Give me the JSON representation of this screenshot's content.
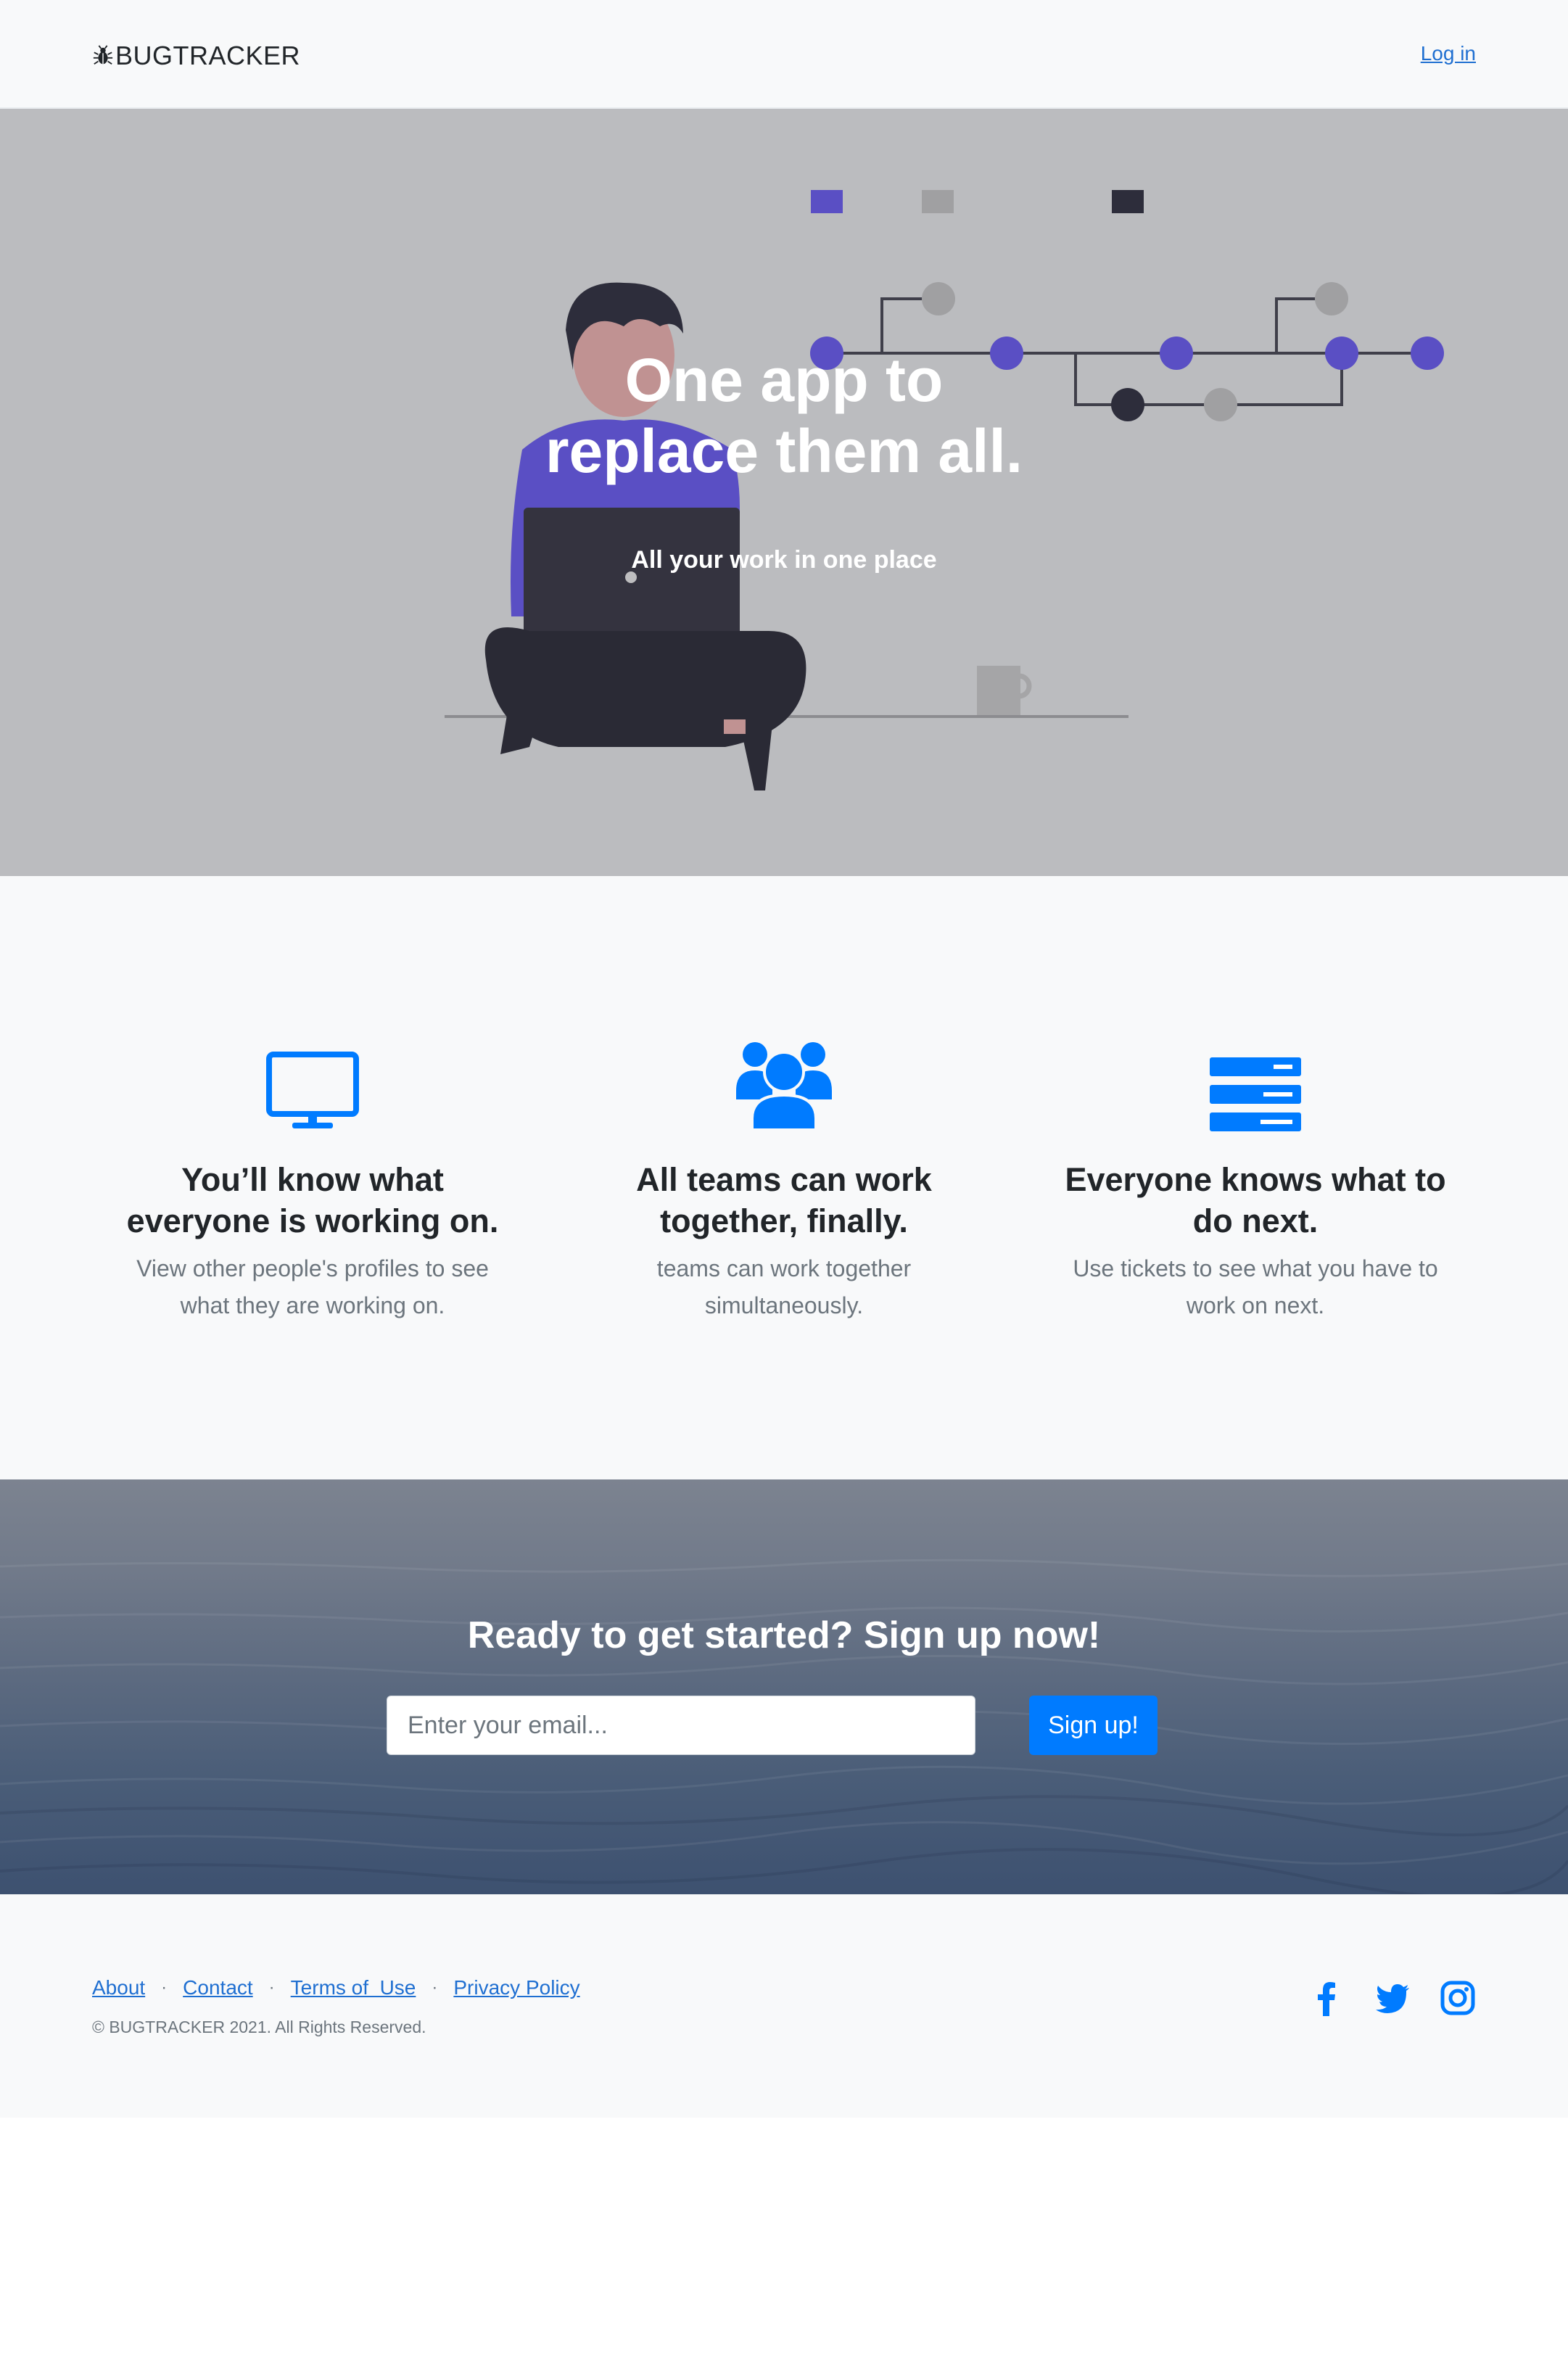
{
  "navbar": {
    "brand_icon": "bug-icon",
    "brand": "BUGTRACKER",
    "login_label": "Log in"
  },
  "hero": {
    "title_line1": "One app to",
    "title_line2": "replace them all.",
    "subtitle": "All your work in one place",
    "illustration": "person-with-laptop-and-branch-graph",
    "colors": {
      "background": "#bbbcbf",
      "accent": "#5a4fc4",
      "dark": "#2d2d3b",
      "gray": "#a0a0a2"
    }
  },
  "features": [
    {
      "icon": "desktop-icon",
      "title": "You’ll know what everyone is working on.",
      "text": "View other people's profiles to see what they are working on."
    },
    {
      "icon": "users-icon",
      "title": "All teams can work together, finally.",
      "text": "teams can work together simultaneously."
    },
    {
      "icon": "server-stack-icon",
      "title": "Everyone knows what to do next.",
      "text": "Use tickets to see what you have to work on next."
    }
  ],
  "cta": {
    "heading": "Ready to get started? Sign up now!",
    "email_placeholder": "Enter your email...",
    "button_label": "Sign up!"
  },
  "footer": {
    "links": [
      "About",
      "Contact",
      "Terms of  Use",
      "Privacy Policy"
    ],
    "copyright": "© BUGTRACKER 2021. All Rights Reserved.",
    "social": [
      "facebook-icon",
      "twitter-icon",
      "instagram-icon"
    ]
  },
  "colors": {
    "primary": "#007bff",
    "link": "#1f6fd1",
    "muted": "#6c757d",
    "light": "#f8f9fa"
  }
}
